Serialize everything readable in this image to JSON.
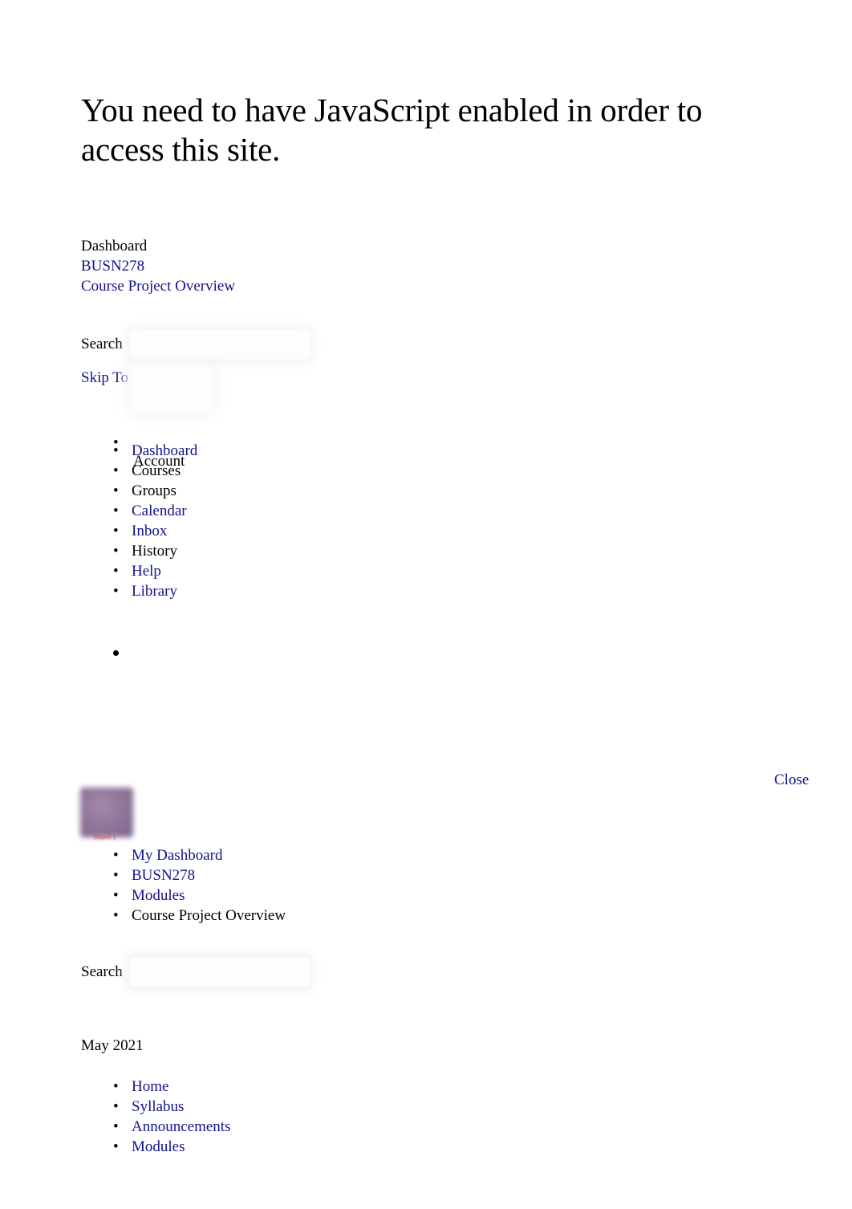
{
  "page": {
    "js_warning": "You need to have JavaScript enabled in order to access this site.",
    "background_color": "#ffffff",
    "link_color": "#12128c",
    "text_color": "#000000"
  },
  "top_breadcrumb": {
    "items": [
      {
        "label": "Dashboard",
        "is_link": false
      },
      {
        "label": "BUSN278",
        "is_link": true
      },
      {
        "label": "Course Project Overview",
        "is_link": true
      }
    ]
  },
  "search_primary": {
    "label": "Search",
    "value": "",
    "placeholder": ""
  },
  "search_secondary": {
    "label": "Search",
    "value": "",
    "placeholder": ""
  },
  "skip_link": {
    "label": "Skip To Content"
  },
  "global_nav": {
    "items": [
      {
        "label": "Account",
        "is_link": false,
        "icon": "user-avatar-image"
      },
      {
        "label": "Dashboard",
        "is_link": true
      },
      {
        "label": "Courses",
        "is_link": false
      },
      {
        "label": "Groups",
        "is_link": false
      },
      {
        "label": "Calendar",
        "is_link": true
      },
      {
        "label": "Inbox",
        "is_link": true
      },
      {
        "label": "History",
        "is_link": false
      },
      {
        "label": "Help",
        "is_link": true
      },
      {
        "label": "Library",
        "is_link": true
      }
    ]
  },
  "close_control": {
    "label": "Close"
  },
  "course_image": {
    "caption": "Object 1",
    "color": "#90769a"
  },
  "course_breadcrumb": {
    "items": [
      {
        "label": "My Dashboard",
        "is_link": true
      },
      {
        "label": "BUSN278",
        "is_link": true
      },
      {
        "label": "Modules",
        "is_link": true
      },
      {
        "label": "Course Project Overview",
        "is_link": false
      }
    ]
  },
  "term": {
    "label": "May 2021"
  },
  "course_nav": {
    "items": [
      {
        "label": "Home",
        "is_link": true
      },
      {
        "label": "Syllabus",
        "is_link": true
      },
      {
        "label": "Announcements",
        "is_link": true
      },
      {
        "label": "Modules",
        "is_link": true
      }
    ]
  }
}
